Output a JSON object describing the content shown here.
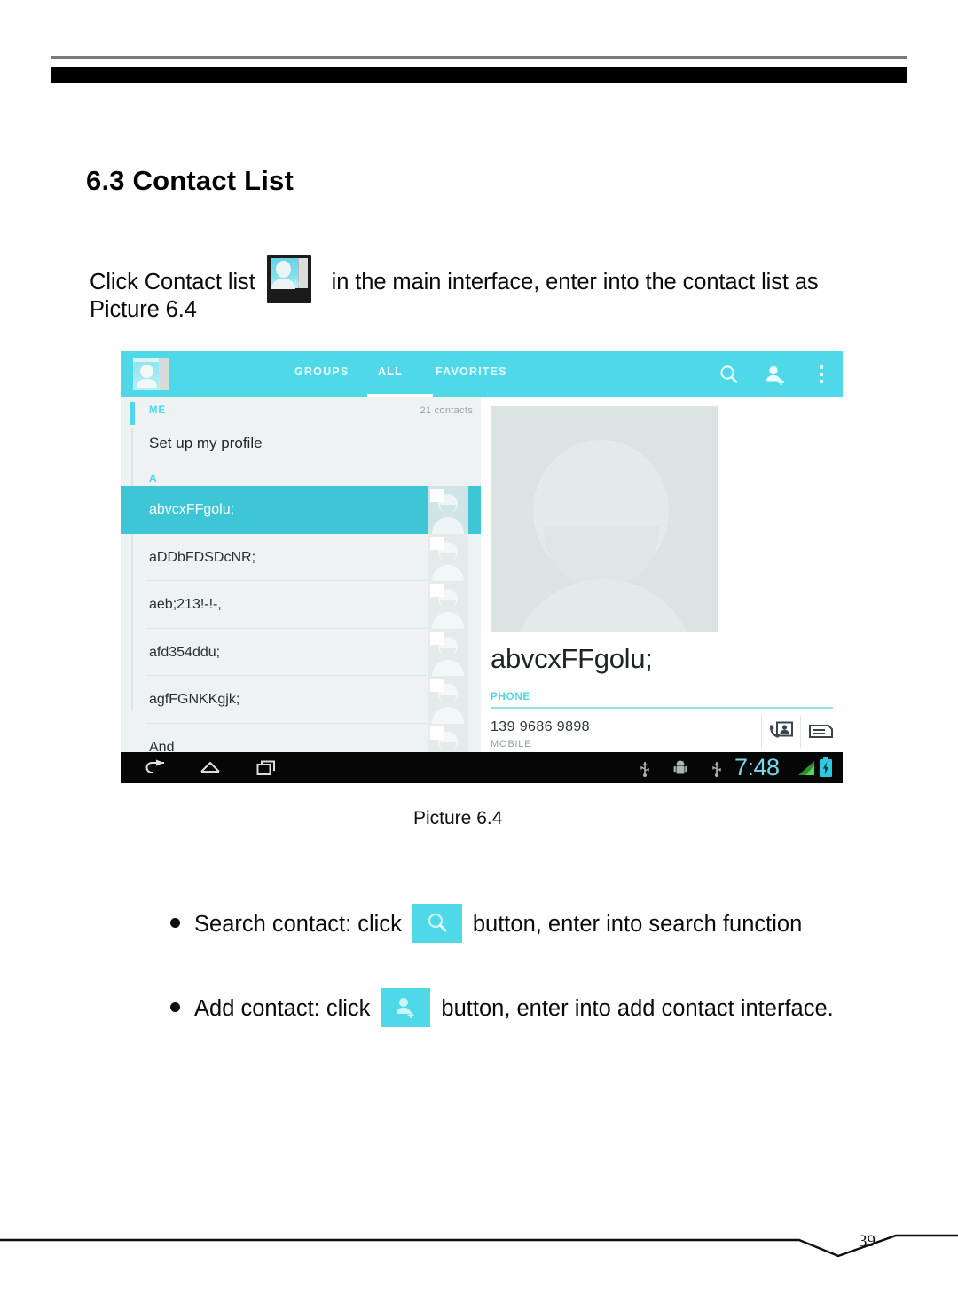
{
  "document": {
    "section_number": "6.3",
    "section_title": "6.3 Contact List",
    "intro_before_icon": "Click Contact list",
    "intro_after_icon": "in the main interface, enter into the contact list as",
    "intro_line2": "Picture 6.4",
    "app_icon_label": "People",
    "figure_caption": "Picture 6.4",
    "page_number": "39"
  },
  "bullets": [
    {
      "before": "Search contact: click",
      "icon": "search-icon",
      "after": "button, enter into search function"
    },
    {
      "before": "Add contact: click",
      "icon": "add-contact-icon",
      "after": "button, enter into add contact interface."
    }
  ],
  "screenshot": {
    "appbar": {
      "app_icon": "people-app-icon",
      "tabs": [
        {
          "label": "GROUPS",
          "selected": false
        },
        {
          "label": "ALL",
          "selected": true
        },
        {
          "label": "FAVORITES",
          "selected": false
        }
      ],
      "actions": [
        {
          "name": "search-icon"
        },
        {
          "name": "add-contact-icon"
        },
        {
          "name": "overflow-menu-icon"
        }
      ]
    },
    "list": {
      "me_header": "ME",
      "contacts_count": "21 contacts",
      "profile_row": "Set up my profile",
      "alpha_header": "A",
      "rows": [
        {
          "name": "abvcxFFgolu;",
          "selected": true
        },
        {
          "name": "aDDbFDSDcNR;",
          "selected": false
        },
        {
          "name": "aeb;213!-!-,",
          "selected": false
        },
        {
          "name": "afd354ddu;",
          "selected": false
        },
        {
          "name": "agfFGNKKgjk;",
          "selected": false
        },
        {
          "name": "And",
          "selected": false
        }
      ]
    },
    "detail": {
      "name": "abvcxFFgolu;",
      "phone_section_label": "PHONE",
      "phone_number": "139 9686 9898",
      "phone_type": "MOBILE",
      "actions": [
        {
          "name": "call-contact-icon"
        },
        {
          "name": "send-message-icon"
        }
      ]
    },
    "navbar": {
      "buttons": [
        {
          "name": "back-icon"
        },
        {
          "name": "home-icon"
        },
        {
          "name": "recents-icon"
        }
      ],
      "status_icons": [
        {
          "name": "usb-icon"
        },
        {
          "name": "android-debug-icon"
        },
        {
          "name": "usb-icon"
        }
      ],
      "clock": "7:48",
      "signal": "signal-bars-icon",
      "battery": "battery-charging-icon"
    }
  },
  "colors": {
    "accent_cyan": "#4fd9e8",
    "selected_row": "#3ec6d6",
    "list_bg": "#eef2f2",
    "navbar_bg": "#060606",
    "clock_cyan": "#79d7e8"
  }
}
